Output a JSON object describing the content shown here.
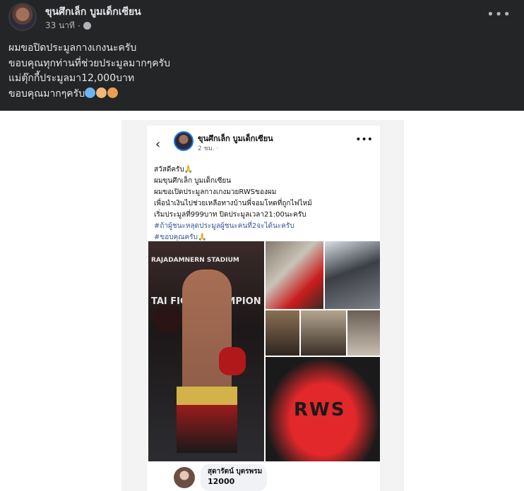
{
  "post": {
    "author": "ขุนศึกเล็ก บูมเด็กเซียน",
    "time": "33 นาที",
    "privacy_icon": "globe-icon",
    "more_icon": "more-options-icon",
    "caption": [
      "ผมขอปิดประมูลกางเกงนะครับ",
      "ขอบคุณทุกท่านที่ช่วยประมูลมากๆครับ",
      "แม่ตุ๊กกี้ประมูลมา12,000บาท",
      "ขอบคุณมากๆครับ"
    ],
    "caption_emoji": [
      "blue-heart",
      "heart-hands",
      "bowing-person"
    ]
  },
  "shared_screenshot": {
    "author": "ขุนศึกเล็ก บูมเด็กเซียน",
    "time": "2 ชม. ·",
    "lines": [
      "สวัสดีครับ🙏",
      "ผมขุนศึกเล็ก บูมเด็กเซียน",
      "ผมขอเปิดประมูลกางเกงมวยRWSของผม",
      "เพื่อนำเงินไปช่วยเหลือทางบ้านพี่จอมโหดที่ถูกไฟไหม้",
      "เริ่มประมูลที่999บาท ปิดประมูลเวลา21:00นะครับ",
      "#ถ้าผู้ชนะหลุดประมูลผู้ชนะคนที่2จะได้นะครับ",
      "#ขอบคุณครับ🙏"
    ],
    "ring_banner": "RAJADAMNERN STADIUM",
    "ring_text": "TAI FIGHT CHAMPION",
    "shorts_text": "RWS",
    "comment": {
      "name": "สุดารัตน์ บุตรพรม",
      "text": "12000"
    }
  }
}
